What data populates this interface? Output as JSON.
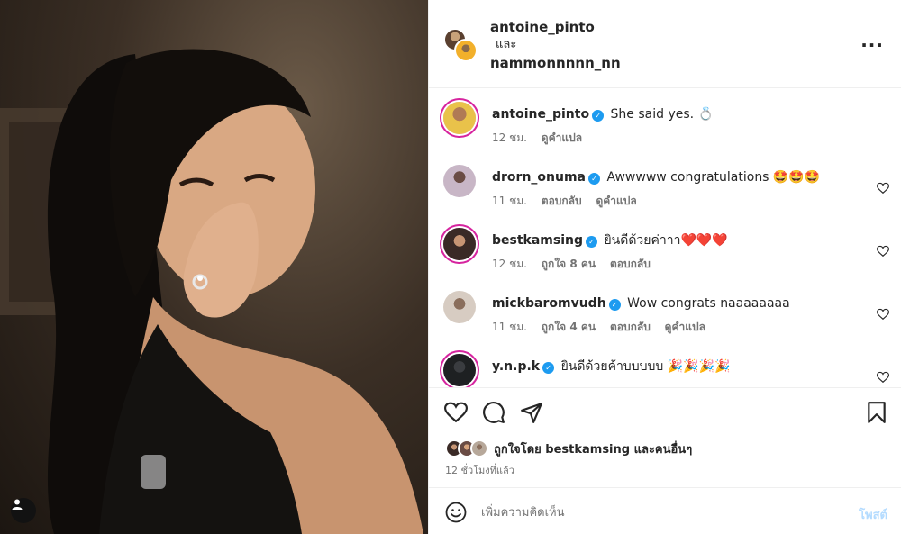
{
  "header": {
    "user1": "antoine_pinto",
    "conjunction": "และ",
    "user2": "nammonnnnn_nn",
    "more_label": "···"
  },
  "comments": [
    {
      "user": "antoine_pinto",
      "verified": true,
      "text": "She said yes. 💍",
      "time": "12 ชม.",
      "actions": [
        "ดูคำแปล"
      ],
      "avatar_color": "#e9c24a"
    },
    {
      "user": "drorn_onuma",
      "verified": true,
      "text": "Awwwww congratulations 🤩🤩🤩",
      "time": "11 ชม.",
      "actions": [
        "ตอบกลับ",
        "ดูคำแปล"
      ],
      "avatar_color": "#c8b6c6"
    },
    {
      "user": "bestkamsing",
      "verified": true,
      "text": "ยินดีด้วยค่าาา❤️❤️❤️",
      "time": "12 ชม.",
      "actions": [
        "ถูกใจ 8 คน",
        "ตอบกลับ"
      ],
      "avatar_color": "#3a2a26"
    },
    {
      "user": "mickbaromvudh",
      "verified": true,
      "text": "Wow congrats naaaaaaaa",
      "time": "11 ชม.",
      "actions": [
        "ถูกใจ 4 คน",
        "ตอบกลับ",
        "ดูคำแปล"
      ],
      "avatar_color": "#b7a89a"
    },
    {
      "user": "y.n.p.k",
      "verified": true,
      "text": "ยินดีด้วยค้าบบบบบ 🎉🎉🎉🎉",
      "time": "",
      "actions": [],
      "avatar_color": "#1e2022"
    }
  ],
  "likes": {
    "text": "ถูกใจโดย bestkamsing และคนอื่นๆ",
    "time": "12 ชั่วโมงที่แล้ว"
  },
  "composer": {
    "placeholder": "เพิ่มความคิดเห็น",
    "post_label": "โพสต์"
  },
  "icons": [
    "heart-icon",
    "comment-icon",
    "share-icon",
    "bookmark-icon",
    "emoji-icon",
    "user-tag-icon",
    "more-icon"
  ],
  "colors": {
    "verified": "#1d9bf0",
    "post_button": "#b3dbff",
    "muted_text": "#737373",
    "story_ring": "#d6249f"
  }
}
